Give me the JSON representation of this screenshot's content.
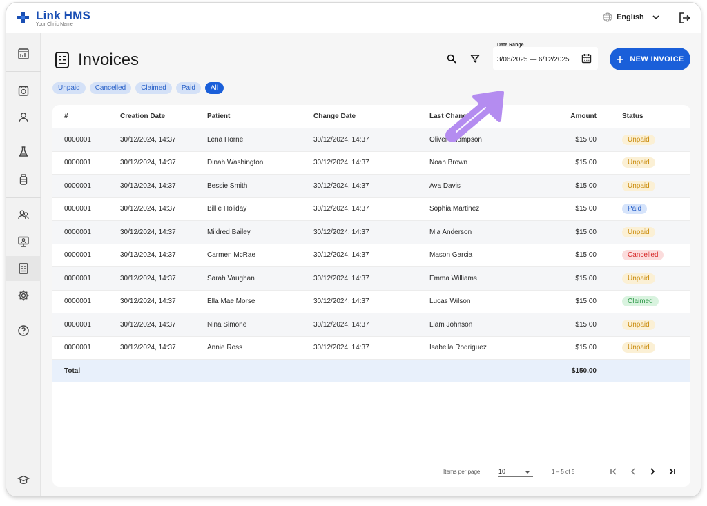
{
  "header": {
    "logo_title": "Link HMS",
    "logo_subtitle": "Your Clinic Name",
    "language": "English"
  },
  "sidebar": {
    "items": [
      {
        "icon": "dashboard-icon"
      },
      {
        "icon": "appointments-icon"
      },
      {
        "icon": "patient-icon"
      },
      {
        "icon": "lab-icon"
      },
      {
        "icon": "medication-icon"
      },
      {
        "icon": "staff-icon"
      },
      {
        "icon": "telemedicine-icon"
      },
      {
        "icon": "invoices-icon"
      },
      {
        "icon": "settings-icon"
      },
      {
        "icon": "help-icon"
      },
      {
        "icon": "graduation-cap-icon"
      }
    ],
    "active": "invoices-icon"
  },
  "main": {
    "title": "Invoices",
    "date_range_label": "Date Range",
    "date_range_value": "3/06/2025 — 6/12/2025",
    "new_button": "NEW INVOICE",
    "filter_chips": [
      "Unpaid",
      "Cancelled",
      "Claimed",
      "Paid",
      "All"
    ],
    "active_chip": "All"
  },
  "table": {
    "columns": [
      "#",
      "Creation Date",
      "Patient",
      "Change Date",
      "Last Change by",
      "Amount",
      "Status"
    ],
    "rows": [
      {
        "id": "0000001",
        "created": "30/12/2024, 14:37",
        "patient": "Lena Horne",
        "changed": "30/12/2024, 14:37",
        "by": "Oliver Thompson",
        "amount": "$15.00",
        "status": "Unpaid"
      },
      {
        "id": "0000001",
        "created": "30/12/2024, 14:37",
        "patient": "Dinah Washington",
        "changed": "30/12/2024, 14:37",
        "by": "Noah Brown",
        "amount": "$15.00",
        "status": "Unpaid"
      },
      {
        "id": "0000001",
        "created": "30/12/2024, 14:37",
        "patient": "Bessie Smith",
        "changed": "30/12/2024, 14:37",
        "by": "Ava Davis",
        "amount": "$15.00",
        "status": "Unpaid"
      },
      {
        "id": "0000001",
        "created": "30/12/2024, 14:37",
        "patient": "Billie Holiday",
        "changed": "30/12/2024, 14:37",
        "by": "Sophia Martinez",
        "amount": "$15.00",
        "status": "Paid"
      },
      {
        "id": "0000001",
        "created": "30/12/2024, 14:37",
        "patient": "Mildred Bailey",
        "changed": "30/12/2024, 14:37",
        "by": "Mia Anderson",
        "amount": "$15.00",
        "status": "Unpaid"
      },
      {
        "id": "0000001",
        "created": "30/12/2024, 14:37",
        "patient": "Carmen McRae",
        "changed": "30/12/2024, 14:37",
        "by": "Mason Garcia",
        "amount": "$15.00",
        "status": "Cancelled"
      },
      {
        "id": "0000001",
        "created": "30/12/2024, 14:37",
        "patient": "Sarah Vaughan",
        "changed": "30/12/2024, 14:37",
        "by": "Emma Williams",
        "amount": "$15.00",
        "status": "Unpaid"
      },
      {
        "id": "0000001",
        "created": "30/12/2024, 14:37",
        "patient": "Ella Mae Morse",
        "changed": "30/12/2024, 14:37",
        "by": "Lucas Wilson",
        "amount": "$15.00",
        "status": "Claimed"
      },
      {
        "id": "0000001",
        "created": "30/12/2024, 14:37",
        "patient": "Nina Simone",
        "changed": "30/12/2024, 14:37",
        "by": "Liam Johnson",
        "amount": "$15.00",
        "status": "Unpaid"
      },
      {
        "id": "0000001",
        "created": "30/12/2024, 14:37",
        "patient": "Annie Ross",
        "changed": "30/12/2024, 14:37",
        "by": "Isabella Rodriguez",
        "amount": "$15.00",
        "status": "Unpaid"
      }
    ],
    "total_label": "Total",
    "total_amount": "$150.00"
  },
  "pagination": {
    "items_per_page_label": "Items per page:",
    "items_per_page": "10",
    "range": "1 – 5 of 5"
  },
  "colors": {
    "primary": "#1a5fd9",
    "brand": "#1a4fb4",
    "annotation_arrow": "#b48cf0"
  }
}
